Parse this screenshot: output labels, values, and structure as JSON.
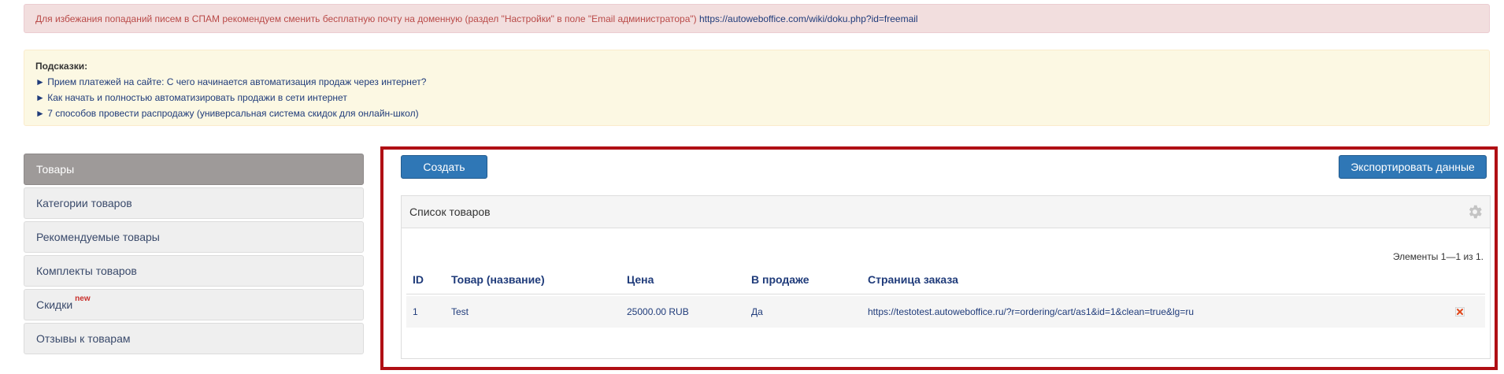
{
  "notice": {
    "text": "Для избежания попаданий писем в СПАМ рекомендуем сменить бесплатную почту на доменную (раздел \"Настройки\" в поле \"Email администратора\")",
    "link": "https://autoweboffice.com/wiki/doku.php?id=freemail"
  },
  "hints": {
    "title": "Подсказки:",
    "items": [
      "► Прием платежей на сайте: С чего начинается автоматизация продаж через интернет?",
      "► Как начать и полностью автоматизировать продажи в сети интернет",
      "► 7 способов провести распродажу (универсальная система скидок для онлайн-школ)"
    ]
  },
  "sidebar": {
    "items": [
      {
        "label": "Товары",
        "active": true
      },
      {
        "label": "Категории товаров"
      },
      {
        "label": "Рекомендуемые товары"
      },
      {
        "label": "Комплекты товаров"
      },
      {
        "label": "Скидки",
        "badge": "new"
      },
      {
        "label": "Отзывы к товарам"
      }
    ]
  },
  "toolbar": {
    "create_label": "Создать",
    "export_label": "Экспортировать данные"
  },
  "panel": {
    "title": "Список товаров",
    "count_text": "Элементы 1—1 из 1.",
    "columns": [
      "ID",
      "Товар (название)",
      "Цена",
      "В продаже",
      "Страница заказа"
    ],
    "rows": [
      {
        "id": "1",
        "name": "Test",
        "price": "25000.00 RUB",
        "on_sale": "Да",
        "order_page": "https://testotest.autoweboffice.ru/?r=ordering/cart/as1&id=1&clean=true&lg=ru"
      }
    ]
  },
  "icons": {
    "settings": "gear-icon",
    "delete": "delete-icon"
  },
  "colors": {
    "primary_button": "#2f77b6",
    "highlight_frame": "#b00f14",
    "danger_bg": "#f2dede",
    "warning_bg": "#fcf8e3",
    "active_sidebar": "#9e9a99"
  }
}
